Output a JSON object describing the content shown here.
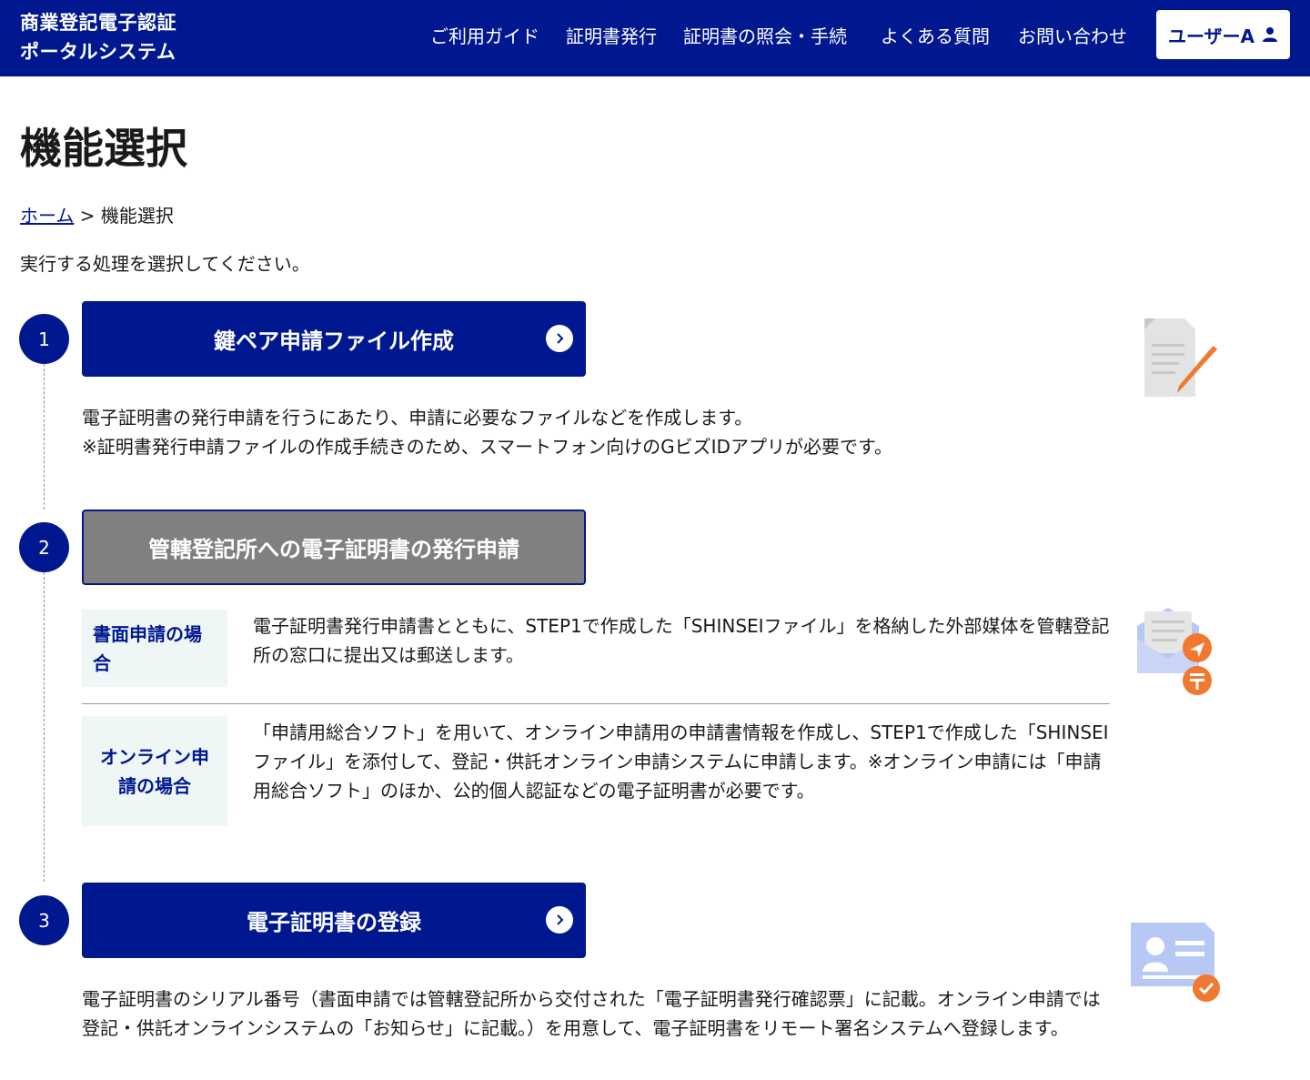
{
  "header": {
    "logo": "商業登記電子認証\nポータルシステム",
    "nav": [
      "ご利用ガイド",
      "証明書発行",
      "証明書の照会・手続",
      "よくある質問",
      "お問い合わせ"
    ],
    "user_label": "ユーザーA",
    "user_icon": "person-icon"
  },
  "page_title": "機能選択",
  "breadcrumb": {
    "home": "ホーム",
    "separator": ">",
    "current": "機能選択"
  },
  "intro": "実行する処理を選択してください。",
  "steps": [
    {
      "number": "1",
      "button_label": "鍵ペア申請ファイル作成",
      "lines": [
        "電子証明書の発行申請を行うにあたり、申請に必要なファイルなどを作成します。",
        "※証明書発行申請ファイルの作成手続きのため、スマートフォン向けのGビズIDアプリが必要です。"
      ],
      "illustration": "document-pen-icon"
    },
    {
      "number": "2",
      "button_label": "管轄登記所への電子証明書の発行申請",
      "paper": {
        "label": "書面申請の場合",
        "text": "電子証明書発行申請書とともに、STEP1で作成した「SHINSEIファイル」を格納した外部媒体を管轄登記所の窓口に提出又は郵送します。"
      },
      "online": {
        "label": "オンライン申請の場合",
        "text": "「申請用総合ソフト」を用いて、オンライン申請用の申請書情報を作成し、STEP1で作成した「SHINSEIファイル」を添付して、登記・供託オンライン申請システムに申請します。※オンライン申請には「申請用総合ソフト」のほか、公的個人認証などの電子証明書が必要です。"
      },
      "illustration": "mail-send-icon"
    },
    {
      "number": "3",
      "button_label": "電子証明書の登録",
      "text": "電子証明書のシリアル番号（書面申請では管轄登記所から交付された「電子証明書発行確認票」に記載。オンライン申請では登記・供託オンラインシステムの「お知らせ」に記載。）を用意して、電子証明書をリモート署名システムへ登録します。",
      "illustration": "id-card-check-icon"
    }
  ],
  "colors": {
    "brand": "#00188f",
    "disabled": "#808080",
    "accent": "#f07830",
    "label_bg": "#eef6f6"
  }
}
